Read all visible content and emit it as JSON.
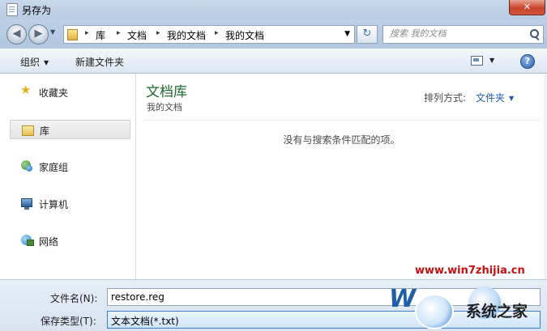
{
  "window": {
    "title": "另存为",
    "close_label": "✕"
  },
  "address": {
    "breadcrumbs": [
      "库",
      "文档",
      "我的文档",
      "我的文档"
    ],
    "separator": "▸",
    "search_placeholder": "搜索 我的文档"
  },
  "toolbar": {
    "organize_label": "组织",
    "new_folder_label": "新建文件夹"
  },
  "nav": {
    "items": [
      {
        "label": "收藏夹",
        "icon": "star-icon"
      },
      {
        "label": "库",
        "icon": "library-icon",
        "selected": true
      },
      {
        "label": "家庭组",
        "icon": "homegroup-icon"
      },
      {
        "label": "计算机",
        "icon": "computer-icon"
      },
      {
        "label": "网络",
        "icon": "network-icon"
      }
    ]
  },
  "content": {
    "library_title": "文档库",
    "library_subtitle": "我的文档",
    "arrange_label": "排列方式:",
    "arrange_value": "文件夹",
    "empty_message": "没有与搜索条件匹配的项。"
  },
  "form": {
    "filename_label": "文件名(N):",
    "filename_value": "restore.reg",
    "filetype_label": "保存类型(T):",
    "filetype_value": "文本文档(*.txt)"
  },
  "watermark": {
    "url": "www.win7zhijia.cn",
    "brand": "系统之家",
    "logo_text": "W"
  },
  "colors": {
    "library_title": "#1c6b2e",
    "arrange_link": "#1e5ea8",
    "watermark_url": "#c40f0f"
  }
}
